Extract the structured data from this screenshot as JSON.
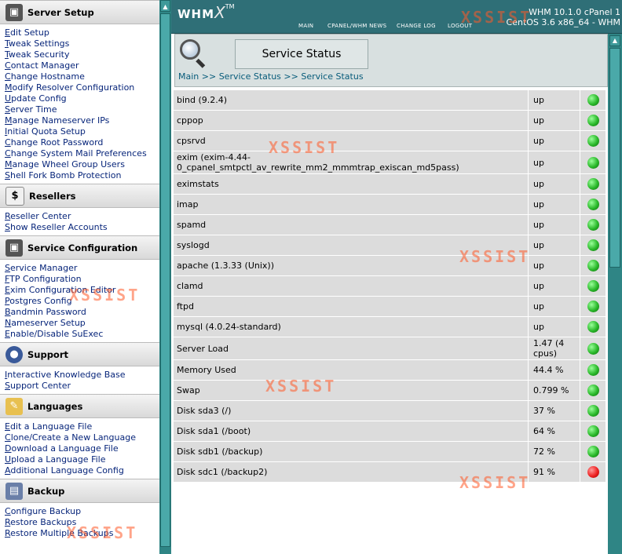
{
  "sidebar": {
    "sections": [
      {
        "title": "Server Setup",
        "icon": "server-setup-icon",
        "links": [
          "Edit Setup",
          "Tweak Settings",
          "Tweak Security",
          "Contact Manager",
          "Change Hostname",
          "Modify Resolver Configuration",
          "Update Config",
          "Server Time",
          "Manage Nameserver IPs",
          "Initial Quota Setup",
          "Change Root Password",
          "Change System Mail Preferences",
          "Manage Wheel Group Users",
          "Shell Fork Bomb Protection"
        ]
      },
      {
        "title": "Resellers",
        "icon": "dollar-icon",
        "links": [
          "Reseller Center",
          "Show Reseller Accounts"
        ]
      },
      {
        "title": "Service Configuration",
        "icon": "service-config-icon",
        "links": [
          "Service Manager",
          "FTP Configuration",
          "Exim Configuration Editor",
          "Postgres Config",
          "Bandmin Password",
          "Nameserver Setup",
          "Enable/Disable SuExec"
        ]
      },
      {
        "title": "Support",
        "icon": "support-icon",
        "links": [
          "Interactive Knowledge Base",
          "Support Center"
        ]
      },
      {
        "title": "Languages",
        "icon": "pencil-icon",
        "links": [
          "Edit a Language File",
          "Clone/Create a New Language",
          "Download a Language File",
          "Upload a Language File",
          "Additional Language Config"
        ]
      },
      {
        "title": "Backup",
        "icon": "backup-icon",
        "links": [
          "Configure Backup",
          "Restore Backups",
          "Restore Multiple Backups"
        ]
      }
    ]
  },
  "header": {
    "logo_whm": "WHM",
    "logo_x": "X",
    "logo_tm": "TM",
    "nav": [
      "MAIN",
      "CPANEL/WHM NEWS",
      "CHANGE LOG",
      "LOGOUT"
    ],
    "version_line1": "WHM 10.1.0 cPanel 1",
    "version_line2": "CentOS 3.6 x86_64 - WHM"
  },
  "page": {
    "title": "Service Status",
    "breadcrumb": [
      "Main",
      ">>",
      "Service Status",
      ">>",
      "Service Status"
    ]
  },
  "services": [
    {
      "name": "bind (9.2.4)",
      "status": "up",
      "ok": true
    },
    {
      "name": "cppop",
      "status": "up",
      "ok": true
    },
    {
      "name": "cpsrvd",
      "status": "up",
      "ok": true
    },
    {
      "name": "exim (exim-4.44-0_cpanel_smtpctl_av_rewrite_mm2_mmmtrap_exiscan_md5pass)",
      "status": "up",
      "ok": true,
      "tall": true
    },
    {
      "name": "eximstats",
      "status": "up",
      "ok": true
    },
    {
      "name": "imap",
      "status": "up",
      "ok": true
    },
    {
      "name": "spamd",
      "status": "up",
      "ok": true
    },
    {
      "name": "syslogd",
      "status": "up",
      "ok": true
    },
    {
      "name": "apache (1.3.33 (Unix))",
      "status": "up",
      "ok": true
    },
    {
      "name": "clamd",
      "status": "up",
      "ok": true
    },
    {
      "name": "ftpd",
      "status": "up",
      "ok": true
    },
    {
      "name": "mysql (4.0.24-standard)",
      "status": "up",
      "ok": true
    },
    {
      "name": "Server Load",
      "status": "1.47 (4 cpus)",
      "ok": true,
      "tall": true
    },
    {
      "name": "Memory Used",
      "status": "44.4 %",
      "ok": true
    },
    {
      "name": "Swap",
      "status": "0.799 %",
      "ok": true
    },
    {
      "name": "Disk sda3 (/)",
      "status": "37 %",
      "ok": true
    },
    {
      "name": "Disk sda1 (/boot)",
      "status": "64 %",
      "ok": true
    },
    {
      "name": "Disk sdb1 (/backup)",
      "status": "72 %",
      "ok": true
    },
    {
      "name": "Disk sdc1 (/backup2)",
      "status": "91 %",
      "ok": false
    }
  ],
  "watermark": "XSSIST",
  "colors": {
    "status_ok": "#2ab82a",
    "status_bad": "#e22222",
    "header_bg": "#2f6f77",
    "link": "#07257a"
  }
}
